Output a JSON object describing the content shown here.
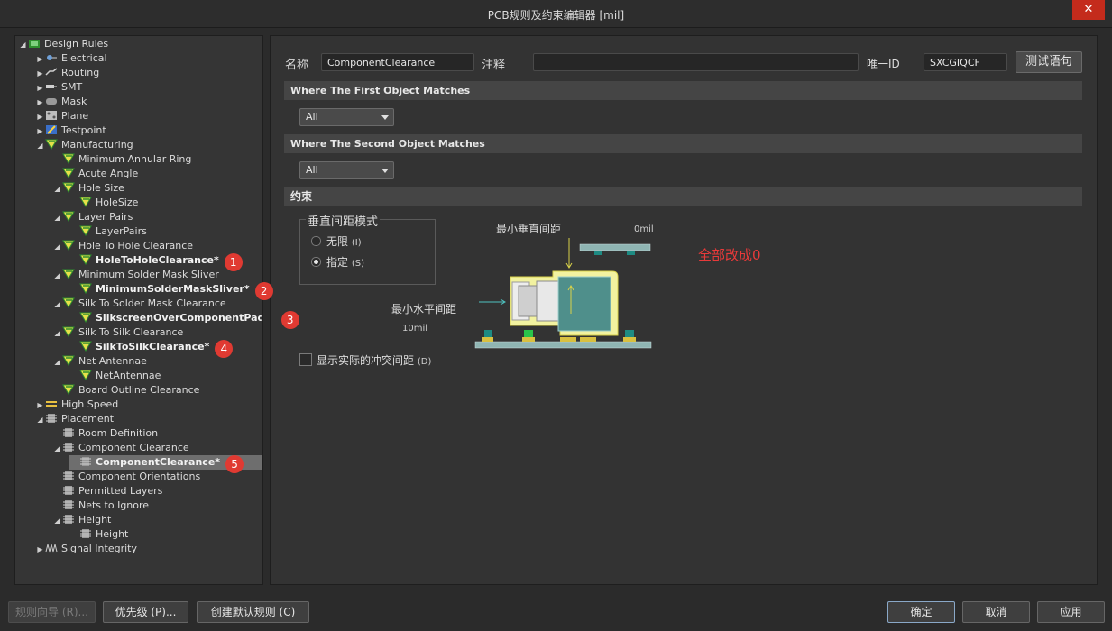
{
  "window": {
    "title": "PCB规则及约束编辑器 [mil]",
    "close_label": "✕"
  },
  "tree": [
    {
      "label": "Design Rules",
      "depth": 0,
      "expander": "open",
      "icon": "design-rules-icon",
      "bold": false
    },
    {
      "label": "Electrical",
      "depth": 1,
      "expander": "closed",
      "icon": "electrical-icon",
      "bold": false
    },
    {
      "label": "Routing",
      "depth": 1,
      "expander": "closed",
      "icon": "routing-icon",
      "bold": false
    },
    {
      "label": "SMT",
      "depth": 1,
      "expander": "closed",
      "icon": "smt-icon",
      "bold": false
    },
    {
      "label": "Mask",
      "depth": 1,
      "expander": "closed",
      "icon": "mask-icon",
      "bold": false
    },
    {
      "label": "Plane",
      "depth": 1,
      "expander": "closed",
      "icon": "plane-icon",
      "bold": false
    },
    {
      "label": "Testpoint",
      "depth": 1,
      "expander": "closed",
      "icon": "testpoint-icon",
      "bold": false
    },
    {
      "label": "Manufacturing",
      "depth": 1,
      "expander": "open",
      "icon": "rule-icon",
      "bold": false
    },
    {
      "label": "Minimum Annular Ring",
      "depth": 2,
      "expander": "none",
      "icon": "rule-icon",
      "bold": false
    },
    {
      "label": "Acute Angle",
      "depth": 2,
      "expander": "none",
      "icon": "rule-icon",
      "bold": false
    },
    {
      "label": "Hole Size",
      "depth": 2,
      "expander": "open",
      "icon": "rule-icon",
      "bold": false
    },
    {
      "label": "HoleSize",
      "depth": 3,
      "expander": "none",
      "icon": "rule-icon",
      "bold": false
    },
    {
      "label": "Layer Pairs",
      "depth": 2,
      "expander": "open",
      "icon": "rule-icon",
      "bold": false
    },
    {
      "label": "LayerPairs",
      "depth": 3,
      "expander": "none",
      "icon": "rule-icon",
      "bold": false
    },
    {
      "label": "Hole To Hole Clearance",
      "depth": 2,
      "expander": "open",
      "icon": "rule-icon",
      "bold": false
    },
    {
      "label": "HoleToHoleClearance*",
      "depth": 3,
      "expander": "none",
      "icon": "rule-icon",
      "bold": true,
      "badge": "1"
    },
    {
      "label": "Minimum Solder Mask Sliver",
      "depth": 2,
      "expander": "open",
      "icon": "rule-icon",
      "bold": false
    },
    {
      "label": "MinimumSolderMaskSliver*",
      "depth": 3,
      "expander": "none",
      "icon": "rule-icon",
      "bold": true,
      "badge": "2"
    },
    {
      "label": "Silk To Solder Mask Clearance",
      "depth": 2,
      "expander": "open",
      "icon": "rule-icon",
      "bold": false
    },
    {
      "label": "SilkscreenOverComponentPads*",
      "depth": 3,
      "expander": "none",
      "icon": "rule-icon",
      "bold": true,
      "badge": "3"
    },
    {
      "label": "Silk To Silk Clearance",
      "depth": 2,
      "expander": "open",
      "icon": "rule-icon",
      "bold": false
    },
    {
      "label": "SilkToSilkClearance*",
      "depth": 3,
      "expander": "none",
      "icon": "rule-icon",
      "bold": true,
      "badge": "4"
    },
    {
      "label": "Net Antennae",
      "depth": 2,
      "expander": "open",
      "icon": "rule-icon",
      "bold": false
    },
    {
      "label": "NetAntennae",
      "depth": 3,
      "expander": "none",
      "icon": "rule-icon",
      "bold": false
    },
    {
      "label": "Board Outline Clearance",
      "depth": 2,
      "expander": "none",
      "icon": "rule-icon",
      "bold": false
    },
    {
      "label": "High Speed",
      "depth": 1,
      "expander": "closed",
      "icon": "high-speed-icon",
      "bold": false
    },
    {
      "label": "Placement",
      "depth": 1,
      "expander": "open",
      "icon": "chip-icon",
      "bold": false
    },
    {
      "label": "Room Definition",
      "depth": 2,
      "expander": "none",
      "icon": "chip-icon",
      "bold": false
    },
    {
      "label": "Component Clearance",
      "depth": 2,
      "expander": "open",
      "icon": "chip-icon",
      "bold": false
    },
    {
      "label": "ComponentClearance*",
      "depth": 3,
      "expander": "none",
      "icon": "chip-icon",
      "bold": true,
      "selected": true,
      "badge": "5"
    },
    {
      "label": "Component Orientations",
      "depth": 2,
      "expander": "none",
      "icon": "chip-icon",
      "bold": false
    },
    {
      "label": "Permitted Layers",
      "depth": 2,
      "expander": "none",
      "icon": "chip-icon",
      "bold": false
    },
    {
      "label": "Nets to Ignore",
      "depth": 2,
      "expander": "none",
      "icon": "chip-icon",
      "bold": false
    },
    {
      "label": "Height",
      "depth": 2,
      "expander": "open",
      "icon": "chip-icon",
      "bold": false
    },
    {
      "label": "Height",
      "depth": 3,
      "expander": "none",
      "icon": "chip-icon",
      "bold": false
    },
    {
      "label": "Signal Integrity",
      "depth": 1,
      "expander": "closed",
      "icon": "signal-integrity-icon",
      "bold": false
    }
  ],
  "form": {
    "name_label": "名称",
    "name_value": "ComponentClearance",
    "comment_label": "注释",
    "comment_value": "",
    "uid_label": "唯一ID",
    "uid_value": "SXCGIQCF",
    "test_button": "测试语句"
  },
  "sections": {
    "first": "Where The First Object Matches",
    "second": "Where The Second Object Matches",
    "constraint": "约束"
  },
  "combos": {
    "first": "All",
    "second": "All"
  },
  "vertical_mode": {
    "title": "垂直间距模式",
    "options": [
      {
        "label": "无限",
        "hotkey": "(I)",
        "selected": false
      },
      {
        "label": "指定",
        "hotkey": "(S)",
        "selected": true
      }
    ]
  },
  "diagram": {
    "min_vertical_label": "最小垂直间距",
    "min_vertical_value": "0mil",
    "min_horizontal_label": "最小水平间距",
    "min_horizontal_value": "10mil"
  },
  "annotation": "全部改成0",
  "show_actual": {
    "label": "显示实际的冲突间距",
    "hotkey": "(D)",
    "checked": false
  },
  "footer": {
    "rule_wizard": "规则向导 (R)...",
    "priority": "优先级 (P)...",
    "create_default": "创建默认规则 (C)",
    "ok": "确定",
    "cancel": "取消",
    "apply": "应用"
  },
  "colors": {
    "accent_red": "#e03a32",
    "annotation_red": "#e83a3a",
    "selection": "#6e6e6e",
    "board_green": "#7f9f9c",
    "keepout_yellow": "#f2f2a0"
  }
}
